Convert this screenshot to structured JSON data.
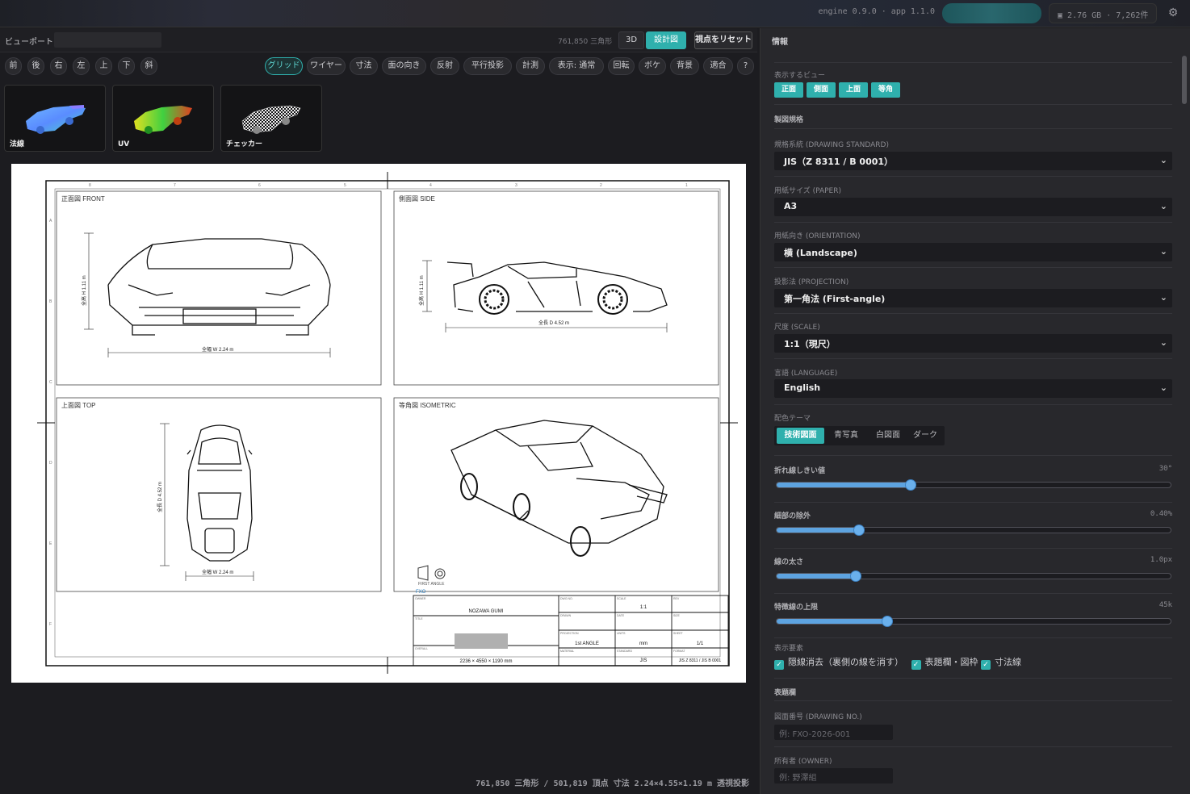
{
  "topbar": {
    "version": "engine 0.9.0 · app 1.1.0",
    "memory": "2.76 GB · 7,262件",
    "settings_icon": "sliders-icon"
  },
  "viewport": {
    "title": "ビューポート —",
    "tri_count": "761,850 三角形",
    "mode_3d": "3D",
    "mode_drawing": "設計図",
    "reset_view": "視点をリセット",
    "tools": [
      "前",
      "後",
      "右",
      "左",
      "上",
      "下",
      "斜"
    ],
    "pills": [
      "グリッド",
      "ワイヤー",
      "寸法",
      "面の向き",
      "反射",
      "平行投影",
      "計測",
      "表示: 通常",
      "回転",
      "ボケ",
      "背景",
      "適合",
      "?"
    ],
    "thumbs": [
      "法線",
      "UV",
      "チェッカー"
    ],
    "status": "761,850 三角形 / 501,819 頂点  寸法 2.24×4.55×1.19 m  透視投影"
  },
  "sheet": {
    "front_label": "正面図 FRONT",
    "side_label": "側面図 SIDE",
    "top_label": "上面図 TOP",
    "iso_label": "等角図 ISOMETRIC",
    "front_width": "全幅 W 2.24 m",
    "front_height": "全高 H 1.11 m",
    "side_length": "全長 D 4.52 m",
    "side_height": "全高 H 1.11 m",
    "top_length": "全長 D 4.52 m",
    "top_width": "全幅 W 2.24 m",
    "first_angle": "FIRST ANGLE",
    "brand": "FXO",
    "owner_lbl": "OWNER",
    "owner": "NOZAWA GUMI",
    "title_lbl": "TITLE",
    "overall_lbl": "OVERALL",
    "overall": "2236 × 4550 × 1190 mm",
    "dwg_lbl": "DWG NO.",
    "drawn_lbl": "DRAWN",
    "projection_lbl": "PROJECTION",
    "projection": "1st ANGLE",
    "material_lbl": "MATERIAL",
    "scale_lbl": "SCALE",
    "scale": "1:1",
    "date_lbl": "DATE",
    "units_lbl": "UNITS",
    "units": "mm",
    "standard_lbl": "STANDARD",
    "standard": "JIS",
    "rev_lbl": "REV",
    "size_lbl": "SIZE",
    "sheet_lbl": "SHEET",
    "sheet_no": "1/1",
    "format_lbl": "FORMAT",
    "format": "JIS Z 8311 / JIS B 0001",
    "col_marks": [
      "8",
      "7",
      "6",
      "5",
      "4",
      "3",
      "2",
      "1"
    ],
    "row_marks": [
      "A",
      "B",
      "C",
      "D",
      "E",
      "F"
    ]
  },
  "panel": {
    "heading": "情報",
    "view_label": "表示するビュー",
    "views": [
      "正面",
      "側面",
      "上面",
      "等角"
    ],
    "standard_header": "製図規格",
    "fields": [
      {
        "label": "規格系統 (DRAWING STANDARD)",
        "value": "JIS（Z 8311 / B 0001）"
      },
      {
        "label": "用紙サイズ (PAPER)",
        "value": "A3"
      },
      {
        "label": "用紙向き (ORIENTATION)",
        "value": "横 (Landscape)"
      },
      {
        "label": "投影法 (PROJECTION)",
        "value": "第一角法 (First-angle)"
      },
      {
        "label": "尺度 (SCALE)",
        "value": "1:1（現尺）"
      },
      {
        "label": "言語 (LANGUAGE)",
        "value": "English"
      }
    ],
    "theme_label": "配色テーマ",
    "themes": [
      "技術図面",
      "青写真",
      "白図面",
      "ダーク"
    ],
    "sliders": [
      {
        "label": "折れ線しきい値",
        "value": "30°",
        "fraction": 0.34
      },
      {
        "label": "細部の除外",
        "value": "0.40%",
        "fraction": 0.21
      },
      {
        "label": "線の太さ",
        "value": "1.0px",
        "fraction": 0.2
      },
      {
        "label": "特徴線の上限",
        "value": "45k",
        "fraction": 0.28
      }
    ],
    "elements_label": "表示要素",
    "checkboxes": [
      "隠線消去（裏側の線を消す）",
      "表題欄・図枠",
      "寸法線"
    ],
    "titleblock_header": "表題欄",
    "dwgno_label": "図面番号 (DRAWING NO.)",
    "dwgno_placeholder": "例: FXO-2026-001",
    "owner_label": "所有者 (OWNER)",
    "owner_placeholder": "例: 野澤組"
  }
}
